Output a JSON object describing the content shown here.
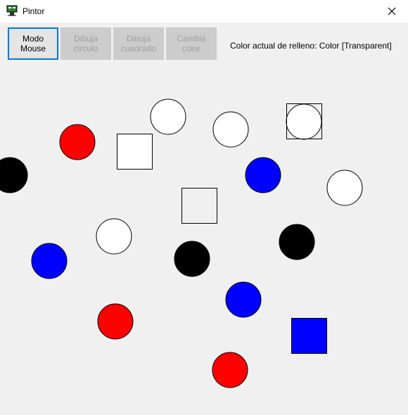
{
  "window": {
    "title": "Pintor",
    "close_icon": "close-icon",
    "app_icon": "paint-app-icon"
  },
  "toolbar": {
    "buttons": [
      {
        "label": "Modo\nMouse",
        "state": "active"
      },
      {
        "label": "Dibuja\ncirculo",
        "state": "disabled"
      },
      {
        "label": "Dibuja\ncuadrado",
        "state": "disabled"
      },
      {
        "label": "Cambia\ncolor",
        "state": "disabled"
      }
    ],
    "status_text": "Color actual de relleno: Color [Transparent]"
  },
  "colors": {
    "red": "#ff0000",
    "blue": "#0000ff",
    "black": "#000000",
    "white": "#ffffff",
    "outline": "#000000"
  }
}
